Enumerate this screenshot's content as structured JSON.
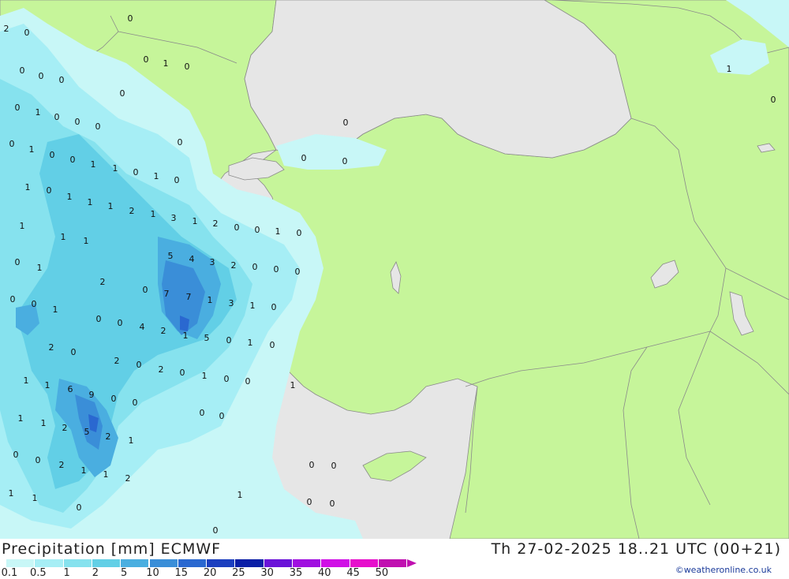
{
  "title": "Precipitation [mm] ECMWF",
  "valid_time": "Th 27-02-2025 18..21 UTC (00+21)",
  "credit": "©weatheronline.co.uk",
  "legend": {
    "ticks": [
      "0.1",
      "0.5",
      "1",
      "2",
      "5",
      "10",
      "15",
      "20",
      "25",
      "30",
      "35",
      "40",
      "45",
      "50"
    ],
    "colors": [
      "#c8f7f7",
      "#a6eef5",
      "#86e2ee",
      "#62cfe6",
      "#4aaee0",
      "#3a8ed8",
      "#2a68d0",
      "#1b3fbf",
      "#0a1ea6",
      "#6a12d8",
      "#a010e0",
      "#d010e6",
      "#e60fcc",
      "#c010b0"
    ]
  },
  "colors": {
    "land": "#c6f59a",
    "sea": "#e6e6e6",
    "border": "#8a8a8a"
  },
  "labels": [
    {
      "v": "2"
    },
    {
      "v": "0"
    },
    {
      "v": "0"
    },
    {
      "v": "0"
    },
    {
      "v": "0"
    },
    {
      "v": "0"
    },
    {
      "v": "0"
    },
    {
      "v": "1"
    },
    {
      "v": "0"
    },
    {
      "v": "0"
    },
    {
      "v": "0"
    },
    {
      "v": "1"
    },
    {
      "v": "0"
    },
    {
      "v": "0"
    },
    {
      "v": "0"
    },
    {
      "v": "0"
    },
    {
      "v": "0"
    },
    {
      "v": "1"
    },
    {
      "v": "0"
    },
    {
      "v": "0"
    },
    {
      "v": "1"
    },
    {
      "v": "1"
    },
    {
      "v": "0"
    },
    {
      "v": "1"
    },
    {
      "v": "0"
    },
    {
      "v": "1"
    },
    {
      "v": "0"
    },
    {
      "v": "1"
    },
    {
      "v": "1"
    },
    {
      "v": "1"
    },
    {
      "v": "2"
    },
    {
      "v": "1"
    },
    {
      "v": "3"
    },
    {
      "v": "1"
    },
    {
      "v": "2"
    },
    {
      "v": "0"
    },
    {
      "v": "0"
    },
    {
      "v": "1"
    },
    {
      "v": "0"
    },
    {
      "v": "1"
    },
    {
      "v": "1"
    },
    {
      "v": "1"
    },
    {
      "v": "5"
    },
    {
      "v": "4"
    },
    {
      "v": "3"
    },
    {
      "v": "2"
    },
    {
      "v": "0"
    },
    {
      "v": "0"
    },
    {
      "v": "0"
    },
    {
      "v": "0"
    },
    {
      "v": "1"
    },
    {
      "v": "2"
    },
    {
      "v": "0"
    },
    {
      "v": "7"
    },
    {
      "v": "7"
    },
    {
      "v": "1"
    },
    {
      "v": "3"
    },
    {
      "v": "1"
    },
    {
      "v": "0"
    },
    {
      "v": "0"
    },
    {
      "v": "0"
    },
    {
      "v": "1"
    },
    {
      "v": "0"
    },
    {
      "v": "0"
    },
    {
      "v": "4"
    },
    {
      "v": "2"
    },
    {
      "v": "1"
    },
    {
      "v": "5"
    },
    {
      "v": "0"
    },
    {
      "v": "1"
    },
    {
      "v": "0"
    },
    {
      "v": "2"
    },
    {
      "v": "0"
    },
    {
      "v": "2"
    },
    {
      "v": "0"
    },
    {
      "v": "2"
    },
    {
      "v": "0"
    },
    {
      "v": "1"
    },
    {
      "v": "0"
    },
    {
      "v": "1"
    },
    {
      "v": "0"
    },
    {
      "v": "6"
    },
    {
      "v": "9"
    },
    {
      "v": "0"
    },
    {
      "v": "0"
    },
    {
      "v": "1"
    },
    {
      "v": "1"
    },
    {
      "v": "1"
    },
    {
      "v": "2"
    },
    {
      "v": "5"
    },
    {
      "v": "2"
    },
    {
      "v": "1"
    },
    {
      "v": "0"
    },
    {
      "v": "2"
    },
    {
      "v": "1"
    },
    {
      "v": "1"
    },
    {
      "v": "2"
    },
    {
      "v": "0"
    },
    {
      "v": "1"
    },
    {
      "v": "1"
    },
    {
      "v": "0"
    },
    {
      "v": "1"
    },
    {
      "v": "0"
    },
    {
      "v": "0"
    },
    {
      "v": "0"
    },
    {
      "v": "0"
    },
    {
      "v": "0"
    },
    {
      "v": "1"
    },
    {
      "v": "0"
    },
    {
      "v": "0"
    },
    {
      "v": "0"
    },
    {
      "v": "0"
    },
    {
      "v": "0"
    },
    {
      "v": "1"
    },
    {
      "v": "0"
    }
  ]
}
